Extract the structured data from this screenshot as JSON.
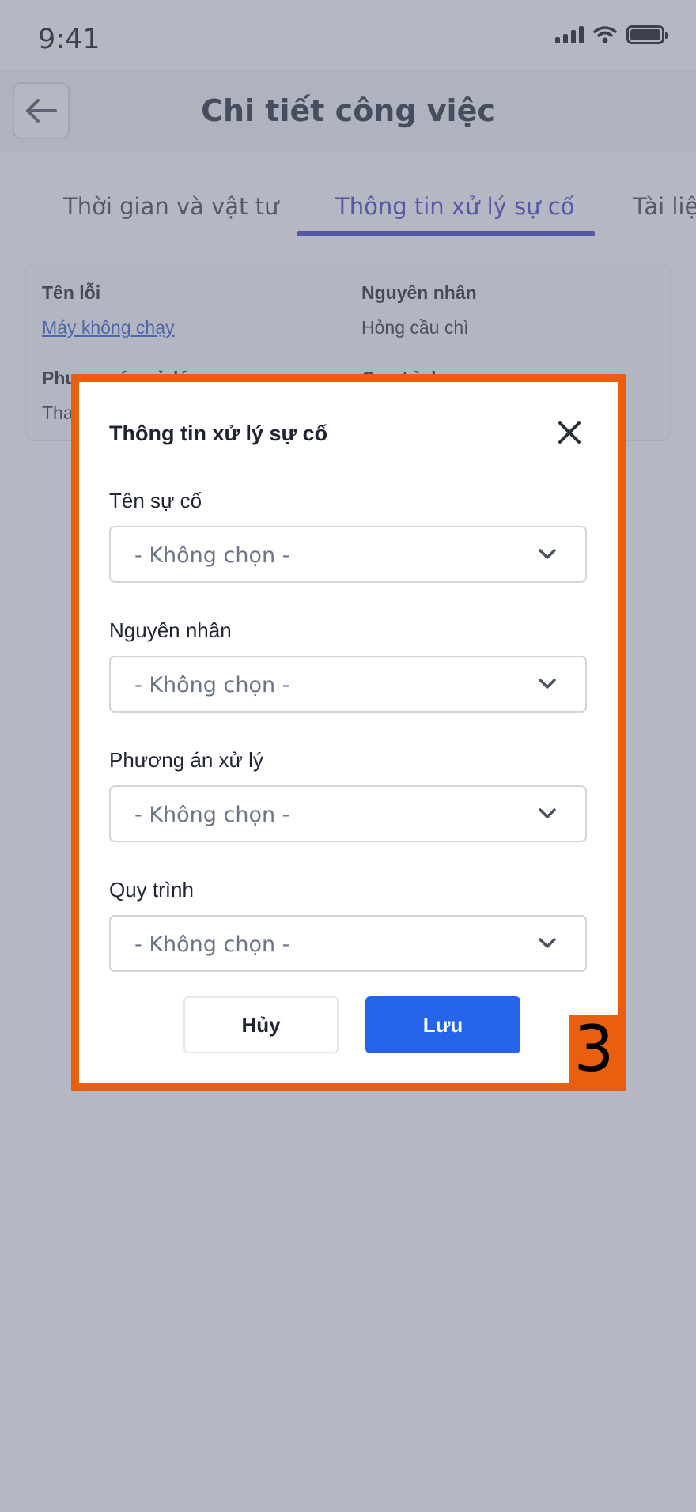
{
  "status_bar": {
    "time": "9:41"
  },
  "header": {
    "title": "Chi tiết công việc"
  },
  "tabs": [
    {
      "label": "Thời gian và vật tư",
      "active": false
    },
    {
      "label": "Thông tin xử lý sự cố",
      "active": true
    },
    {
      "label": "Tài liệu",
      "active": false
    }
  ],
  "info_card": {
    "error_name_label": "Tên lỗi",
    "error_name_value": "Máy không chạy",
    "cause_label": "Nguyên nhân",
    "cause_value": "Hỏng cầu chì",
    "solution_label": "Phương án xử lý",
    "solution_value": "Thay cầu chì",
    "process_label": "Quy trình"
  },
  "dialog": {
    "title": "Thông tin xử lý sự cố",
    "fields": [
      {
        "label": "Tên sự cố",
        "value": "- Không chọn -"
      },
      {
        "label": "Nguyên nhân",
        "value": "- Không chọn -"
      },
      {
        "label": "Phương án xử lý",
        "value": "- Không chọn -"
      },
      {
        "label": "Quy trình",
        "value": "- Không chọn -"
      }
    ],
    "cancel_label": "Hủy",
    "save_label": "Lưu",
    "step_number": "3"
  },
  "icons": [
    "back-arrow-icon",
    "close-icon",
    "chevron-down-icon",
    "signal-icon",
    "wifi-icon",
    "battery-icon"
  ],
  "colors": {
    "accent": "#3c3cc4",
    "primary_button": "#2563eb",
    "highlight": "#e8600f",
    "link": "#2f5fcf"
  }
}
